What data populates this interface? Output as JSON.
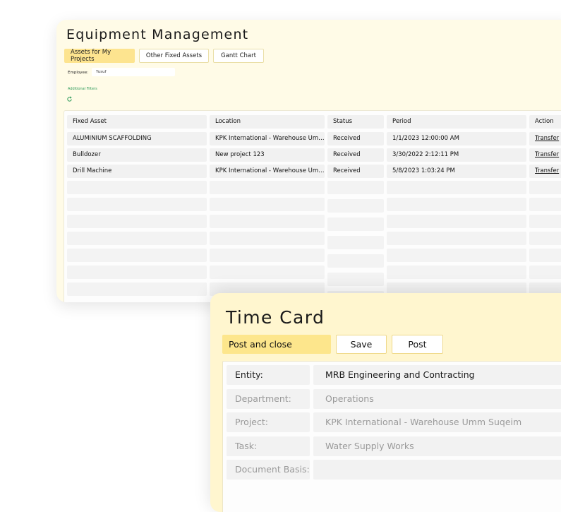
{
  "equipment": {
    "title": "Equipment Management",
    "tabs": [
      {
        "label": "Assets for My Projects",
        "active": true
      },
      {
        "label": "Other Fixed Assets",
        "active": false
      },
      {
        "label": "Gantt Chart",
        "active": false
      }
    ],
    "employee_label": "Employee:",
    "employee_value": "Yusuf",
    "additional_filters": "Additional Filters",
    "refresh_icon": "refresh-icon",
    "columns": [
      "Fixed Asset",
      "Location",
      "Status",
      "Period",
      "Action"
    ],
    "rows": [
      {
        "asset": "ALUMINIUM SCAFFOLDING",
        "location": "KPK International - Warehouse Um…",
        "status": "Received",
        "period": "1/1/2023 12:00:00 AM",
        "action": "Transfer"
      },
      {
        "asset": "Bulldozer",
        "location": "New project 123",
        "status": "Received",
        "period": "3/30/2022 2:12:11 PM",
        "action": "Transfer"
      },
      {
        "asset": "Drill Machine",
        "location": "KPK International - Warehouse Um…",
        "status": "Received",
        "period": "5/8/2023 1:03:24 PM",
        "action": "Transfer"
      }
    ]
  },
  "timecard": {
    "title": "Time Card",
    "buttons": {
      "post_close": "Post and close",
      "save": "Save",
      "post": "Post"
    },
    "fields": [
      {
        "label": "Entity:",
        "value": "MRB Engineering and Contracting"
      },
      {
        "label": "Department:",
        "value": "Operations"
      },
      {
        "label": "Project:",
        "value": "KPK International - Warehouse Umm Suqeim"
      },
      {
        "label": "Task:",
        "value": "Water Supply Works"
      },
      {
        "label": "Document Basis:",
        "value": ""
      }
    ]
  },
  "colors": {
    "accent": "#fde68c",
    "card_bg": "#fff6cf",
    "link_green": "#2e9b5a"
  }
}
